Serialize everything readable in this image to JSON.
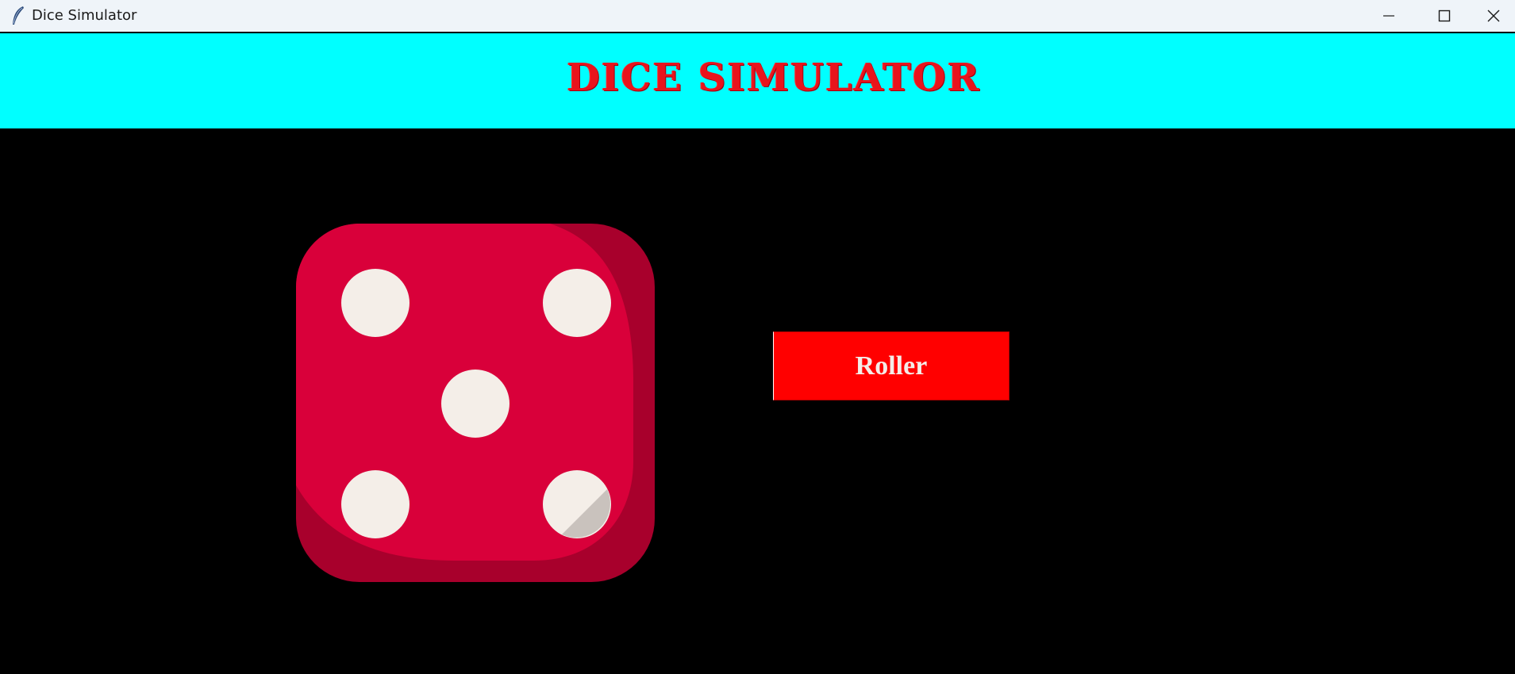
{
  "window": {
    "title": "Dice Simulator",
    "controls": {
      "minimize_icon": "minimize-icon",
      "maximize_icon": "maximize-icon",
      "close_icon": "close-icon"
    },
    "app_icon": "feather-icon"
  },
  "header": {
    "title": "DICE SIMULATOR",
    "background": "#00ffff",
    "text_color": "#e8141c"
  },
  "dice": {
    "face_value": 5,
    "face_color": "#d9003a",
    "shadow_color": "#a8002c",
    "pip_color": "#f4eee8"
  },
  "roll_button": {
    "label": "Roller",
    "background": "#ff0000"
  },
  "colors": {
    "canvas_background": "#000000"
  }
}
